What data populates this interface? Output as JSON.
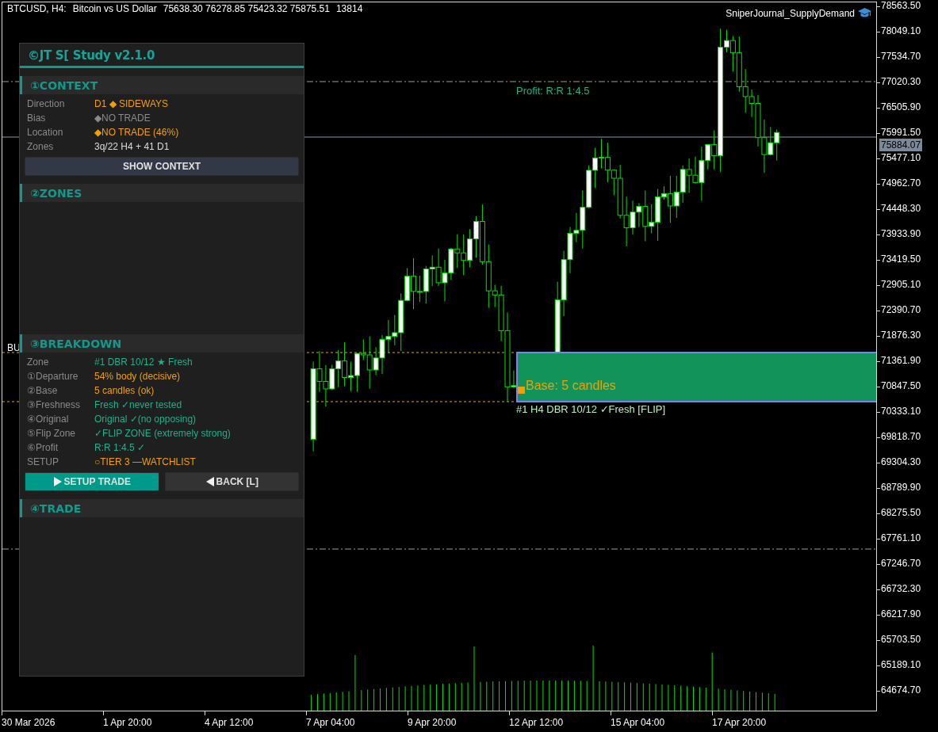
{
  "chart_header": {
    "symbol": "BTCUSD, H4:",
    "description": "Bitcoin vs US Dollar",
    "ohlc": "75638.30 76278.85 75423.32 75875.51",
    "volume": "13814"
  },
  "indicator": {
    "name": "SniperJournal_SupplyDemand"
  },
  "price_axis": {
    "labels": [
      "78563.50",
      "78049.10",
      "77534.70",
      "77020.30",
      "76505.90",
      "75991.50",
      "75477.10",
      "74962.70",
      "74448.30",
      "73933.90",
      "73419.50",
      "72905.10",
      "72390.70",
      "71876.30",
      "71361.90",
      "70847.50",
      "70333.10",
      "69818.70",
      "69304.30",
      "68789.90",
      "68275.50",
      "67761.10",
      "67246.70",
      "66732.30",
      "66217.90",
      "65703.50",
      "65189.10",
      "64674.70"
    ],
    "current_price": "75884.07"
  },
  "time_axis": {
    "labels": [
      "30 Mar 2026",
      "1 Apr 20:00",
      "4 Apr 12:00",
      "7 Apr 04:00",
      "9 Apr 20:00",
      "12 Apr 12:00",
      "15 Apr 04:00",
      "17 Apr 20:00"
    ]
  },
  "chart_labels": {
    "profit": "Profit: R:R 1:4.5",
    "cut_text": "BU"
  },
  "zone": {
    "base_label": "Base: 5 candles",
    "caption": "#1 H4 DBR 10/12 ✓Fresh [FLIP]"
  },
  "panel": {
    "title": "©JT S[ Study v2.1.0",
    "sections": [
      {
        "title": "①CONTEXT",
        "rows": [
          {
            "label": "Direction",
            "value": "D1 ◆ SIDEWAYS",
            "color": "#f0a000"
          },
          {
            "label": "Bias",
            "value": "◆NO TRADE",
            "color": "#8a8a8a"
          },
          {
            "label": "Location",
            "value": "◆NO TRADE (46%)",
            "color": "#f0a000"
          },
          {
            "label": "Zones",
            "value": "3q/22 H4 + 41 D1",
            "color": "#dcdcdc"
          }
        ],
        "buttons": [
          {
            "label": "SHOW CONTEXT",
            "kind": "secondary"
          }
        ]
      },
      {
        "title": "②ZONES"
      },
      {
        "title": "③BREAKDOWN",
        "rows": [
          {
            "label": "Zone",
            "value": "#1 DBR 10/12 ★ Fresh",
            "color": "#1fb08a"
          },
          {
            "label": "①Departure",
            "value": "54% body (decisive)",
            "color": "#f0a000"
          },
          {
            "label": "②Base",
            "value": "5 candles (ok)",
            "color": "#f0a000"
          },
          {
            "label": "③Freshness",
            "value": "Fresh ✓never tested",
            "color": "#1fb08a"
          },
          {
            "label": "④Original",
            "value": "Original ✓(no opposing)",
            "color": "#1fb08a"
          },
          {
            "label": "⑤Flip Zone",
            "value": "✓FLIP ZONE (extremely strong)",
            "color": "#1fb08a"
          },
          {
            "label": "⑥Profit",
            "value": "R:R 1:4.5 ✓",
            "color": "#1fb08a"
          },
          {
            "label": "SETUP",
            "value": "○TIER 3 —WATCHLIST",
            "color": "#f0a000"
          }
        ],
        "buttons": [
          {
            "label": "SETUP TRADE",
            "kind": "primary"
          },
          {
            "label": "BACK [L]",
            "kind": "back"
          }
        ]
      },
      {
        "title": "④TRADE"
      }
    ]
  }
}
